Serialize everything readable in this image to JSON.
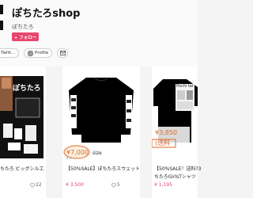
{
  "shop": {
    "title": "ぽちたろshop",
    "subtitle": "ぽちたろ",
    "follow_label": "+ フォロー"
  },
  "links": {
    "twitter_label": "Twitt...",
    "profile_label": "Profile"
  },
  "products": [
    {
      "name": "ちたろ ビッグシルエ",
      "name_line2": "",
      "price": "",
      "likes": ""
    },
    {
      "name": "【50%SALE】ぽちたろスウェット",
      "image_price_tag": "¥7,000",
      "image_size_tag": "size",
      "price": "¥ 3,500",
      "likes": "5",
      "image_caption": "スウ"
    },
    {
      "name": "【50%SALE！送料?3",
      "name_line2": "ちたろGirlsTシャツ",
      "image_price_tag": "¥3,850",
      "image_shipping_tag": "(送料",
      "price": "¥ 1,195",
      "likes": ""
    }
  ],
  "likes_first": "22",
  "colors": {
    "accent": "#e8466b",
    "background": "#f4f4f4",
    "price_red": "#e8466b"
  },
  "icons": [
    "twitter-icon",
    "instagram-icon",
    "mail-icon",
    "heart-icon"
  ]
}
